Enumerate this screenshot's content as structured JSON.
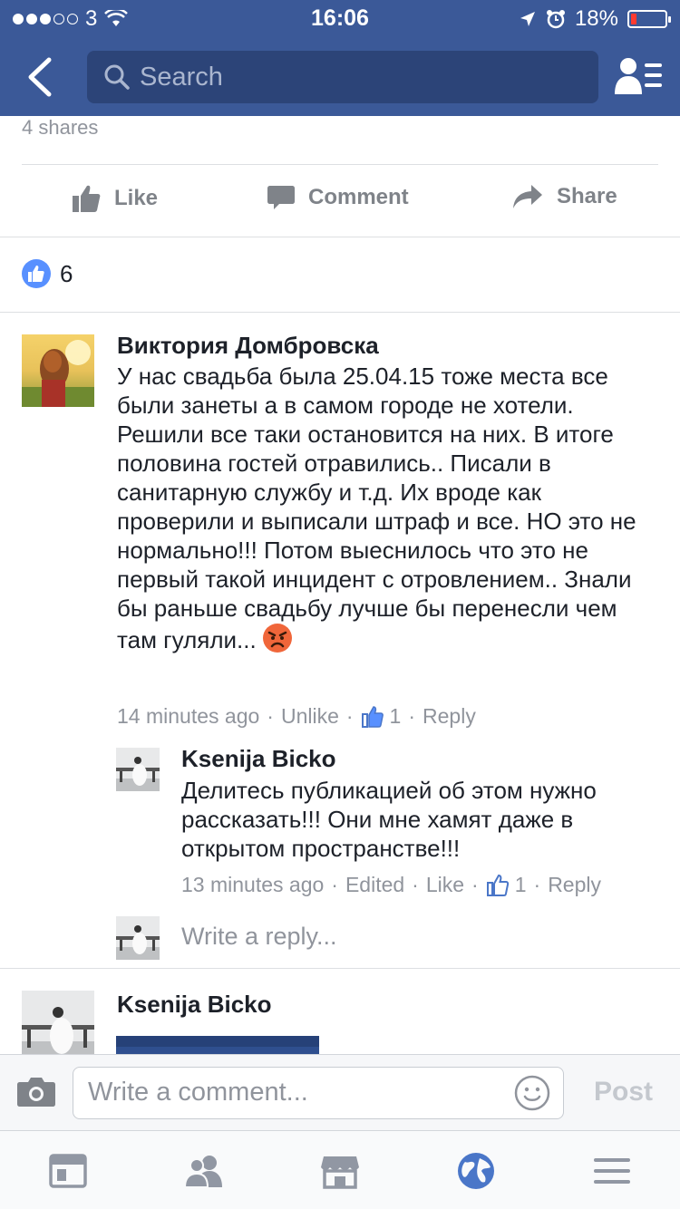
{
  "status_bar": {
    "carrier": "3",
    "time": "16:06",
    "battery": "18%",
    "battery_fraction": 0.18
  },
  "nav": {
    "search_placeholder": "Search"
  },
  "post": {
    "shares": "4 shares",
    "actions": {
      "like": "Like",
      "comment": "Comment",
      "share": "Share"
    },
    "like_count": "6"
  },
  "comments": [
    {
      "author": "Виктория Домбровска",
      "text": "У нас свадьба была 25.04.15 тоже места все были занеты а в самом городе не хотели. Решили все таки остановится на них. В итоге половина гостей отравились.. Писали в санитарную службу и т.д. Их вроде как проверили и выписали штраф и все. НО это не нормально!!! Потом выеснилось что это не первый такой инцидент с отровлением.. Знали бы раньше свадьбу лучше бы перенесли чем там гуляли...",
      "time": "14 minutes ago",
      "action": "Unlike",
      "likes": "1",
      "reply": "Reply",
      "replies": [
        {
          "author": "Ksenija Bicko",
          "text": "Делитесь публикацией об этом нужно рассказать!!! Они мне хамят даже в открытом пространстве!!!",
          "time": "13 minutes ago",
          "edited": "Edited",
          "action": "Like",
          "likes": "1",
          "reply": "Reply"
        }
      ],
      "write_reply": "Write a reply..."
    },
    {
      "author": "Ksenija Bicko"
    }
  ],
  "composer": {
    "placeholder": "Write a comment...",
    "post_label": "Post"
  },
  "colors": {
    "brand": "#3b5998",
    "link_gray": "#90949c",
    "like_blue": "#5890ff",
    "battery_low": "#ff3b30"
  }
}
